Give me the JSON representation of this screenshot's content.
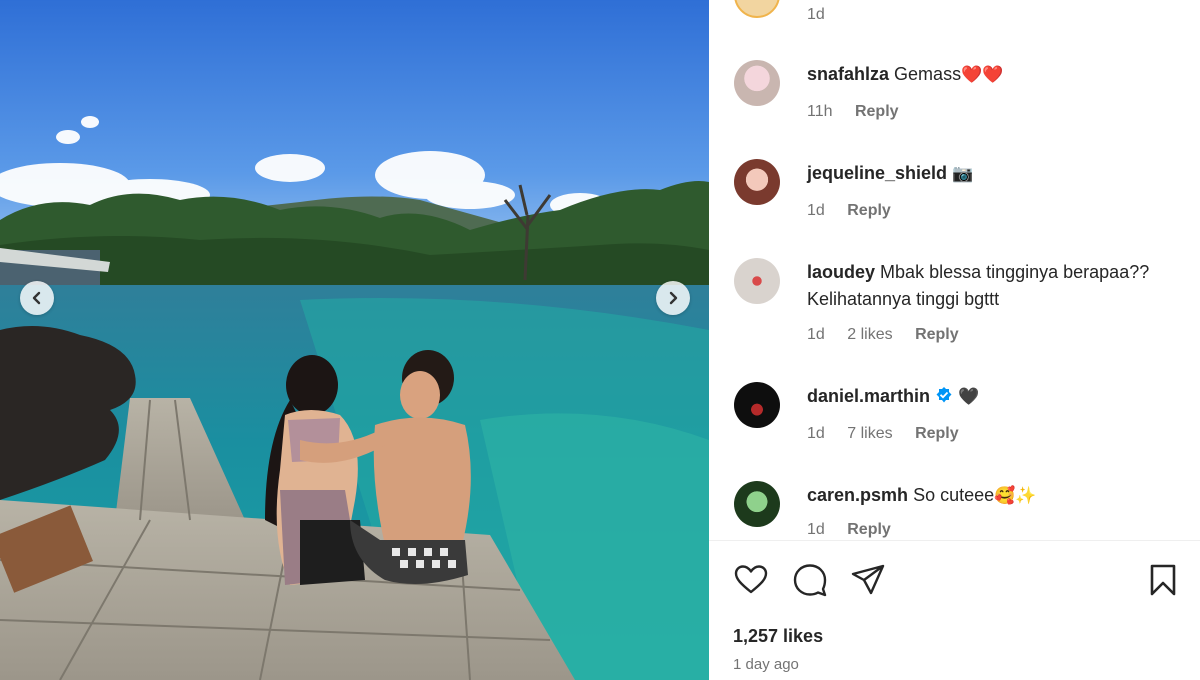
{
  "post": {
    "nav": {
      "prev_icon": "chevron-left-icon",
      "next_icon": "chevron-right-icon"
    }
  },
  "comments": [
    {
      "username": "",
      "text": "",
      "time": "1d",
      "likes": "",
      "reply": ""
    },
    {
      "username": "snafahlza",
      "text": "Gemass",
      "emoji": "❤️❤️",
      "time": "11h",
      "likes": "",
      "reply": "Reply"
    },
    {
      "username": "jequeline_shield",
      "text": "",
      "emoji": "📷",
      "time": "1d",
      "likes": "",
      "reply": "Reply"
    },
    {
      "username": "laoudey",
      "text": "Mbak blessa tingginya berapaa?? Kelihatannya tinggi bgttt",
      "emoji": "",
      "time": "1d",
      "likes": "2 likes",
      "reply": "Reply"
    },
    {
      "username": "daniel.marthin",
      "verified": true,
      "text": "",
      "emoji": "🖤",
      "time": "1d",
      "likes": "7 likes",
      "reply": "Reply"
    },
    {
      "username": "caren.psmh",
      "text": "So cuteee",
      "emoji": "🥰✨",
      "time": "1d",
      "likes": "",
      "reply": "Reply"
    }
  ],
  "actions": {
    "like_icon": "heart-icon",
    "comment_icon": "comment-icon",
    "share_icon": "send-icon",
    "save_icon": "bookmark-icon"
  },
  "likes_count": "1,257 likes",
  "posted_ago": "1 day ago",
  "colors": {
    "text": "#262626",
    "secondary": "#737373",
    "verified": "#0095f6"
  }
}
